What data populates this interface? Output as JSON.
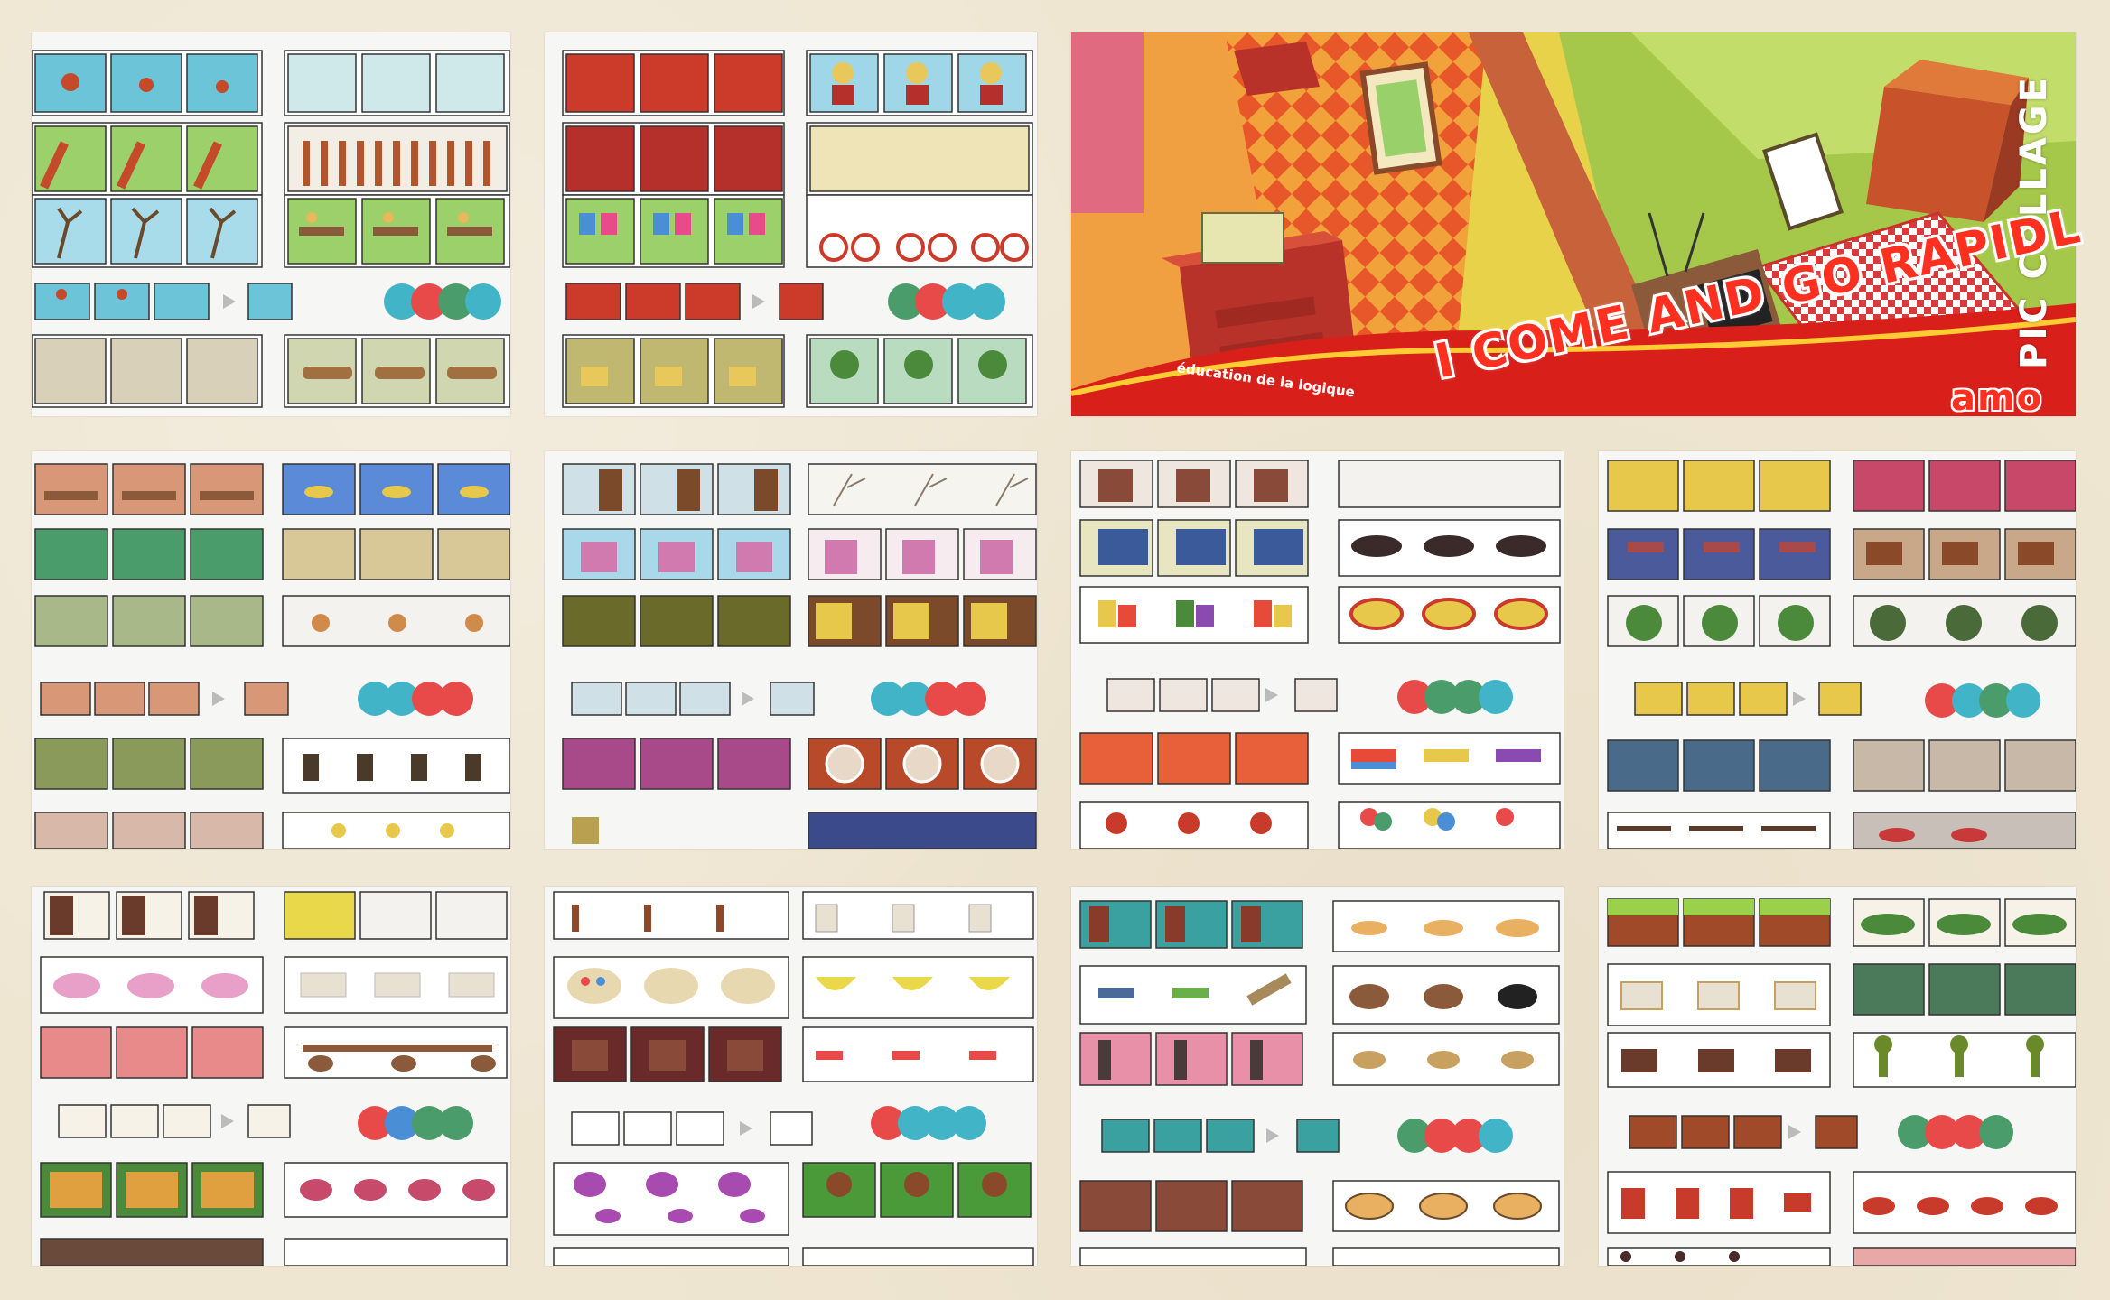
{
  "cover": {
    "title": "I COME AND GO RAPIDL",
    "subtitle": "éducation de la logique",
    "partial_text": "amo"
  },
  "watermark": "PIC COLLAGE",
  "tiles": [
    {
      "id": "page-1",
      "theme": "tree-seasons-and-swings",
      "palette": [
        "#6cc4d8",
        "#9bd06a",
        "#c44a2a",
        "#e8b85a"
      ]
    },
    {
      "id": "page-2",
      "theme": "pot-flowers-bikes",
      "palette": [
        "#cc3a2a",
        "#9bd06a",
        "#4a8fd6",
        "#e8c85a"
      ]
    },
    {
      "id": "cover",
      "theme": "room-illustration"
    },
    {
      "id": "page-3",
      "theme": "table-fish-chairs",
      "palette": [
        "#8a5a3a",
        "#4a9c6a",
        "#d08a4a",
        "#5a8ad8"
      ]
    },
    {
      "id": "page-4",
      "theme": "wardrobe-boxes-branches",
      "palette": [
        "#7a4a2a",
        "#d07ab0",
        "#e8c84a",
        "#3aa0c8"
      ]
    },
    {
      "id": "page-5",
      "theme": "armchair-blocks-drum",
      "palette": [
        "#8a4a3a",
        "#3a5a9a",
        "#e84a3a",
        "#e8c84a"
      ]
    },
    {
      "id": "page-6",
      "theme": "curtains-bags-stools",
      "palette": [
        "#e8c84a",
        "#4a8a3a",
        "#a84a4a",
        "#8a6a4a"
      ]
    },
    {
      "id": "page-7",
      "theme": "window-clothes-bed",
      "palette": [
        "#6a3a2a",
        "#e8a0c8",
        "#e0a040",
        "#4a8a3a"
      ]
    },
    {
      "id": "page-8",
      "theme": "tools-bananas-glasses",
      "palette": [
        "#8a4a2a",
        "#e8d84a",
        "#e84a4a",
        "#a84ab0"
      ]
    },
    {
      "id": "page-9",
      "theme": "keys-bread-dogs",
      "palette": [
        "#3aa0a0",
        "#e8b060",
        "#8a5a3a",
        "#c84a4a"
      ]
    },
    {
      "id": "page-10",
      "theme": "dishes-cups-glasses",
      "palette": [
        "#a04a2a",
        "#4a8a3a",
        "#e8e0d0",
        "#c83a2a"
      ]
    }
  ]
}
